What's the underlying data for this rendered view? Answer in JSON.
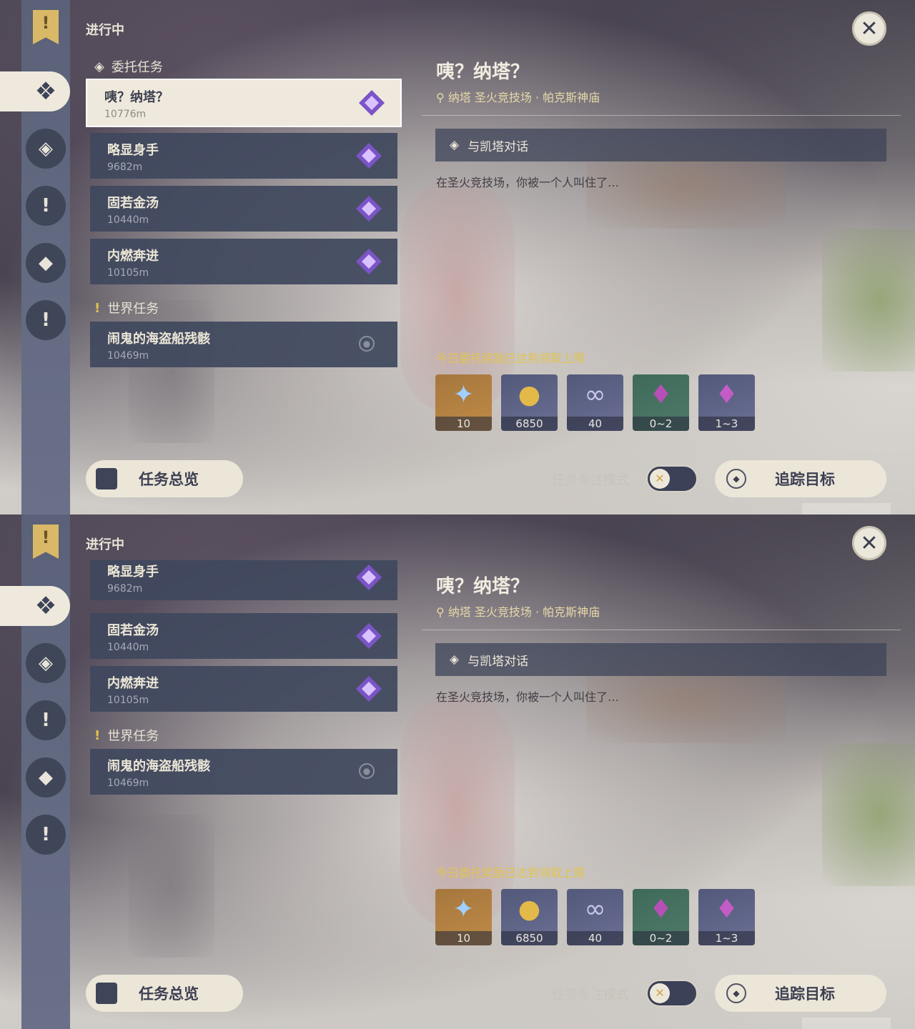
{
  "header": {
    "ongoing": "进行中"
  },
  "sections": {
    "commission": "委托任务",
    "world": "世界任务"
  },
  "quests": [
    {
      "name": "咦？纳塔？",
      "dist": "10776m"
    },
    {
      "name": "略显身手",
      "dist": "9682m"
    },
    {
      "name": "固若金汤",
      "dist": "10440m"
    },
    {
      "name": "内燃奔进",
      "dist": "10105m"
    }
  ],
  "world_quest": {
    "name": "闹鬼的海盗船残骸",
    "dist": "10469m"
  },
  "detail": {
    "title": "咦？纳塔？",
    "location": "纳塔 圣火竞技场 · 帕克斯神庙",
    "objective": "与凯塔对话",
    "description": "在圣火竞技场，你被一个人叫住了…",
    "limit_notice": "今日委托奖励已达到领取上限"
  },
  "rewards": [
    {
      "icon": "primogem-icon",
      "count": "10"
    },
    {
      "icon": "mora-icon",
      "count": "6850"
    },
    {
      "icon": "fellowship-icon",
      "count": "40"
    },
    {
      "icon": "crystal-small-icon",
      "count": "0~2"
    },
    {
      "icon": "crystal-large-icon",
      "count": "1~3"
    }
  ],
  "buttons": {
    "overview": "任务总览",
    "focus_mode": "任务专注模式",
    "track": "追踪目标"
  },
  "colors": {
    "accent_gold": "#e2c44d",
    "panel": "#40485e",
    "cream": "#efe9dd"
  }
}
